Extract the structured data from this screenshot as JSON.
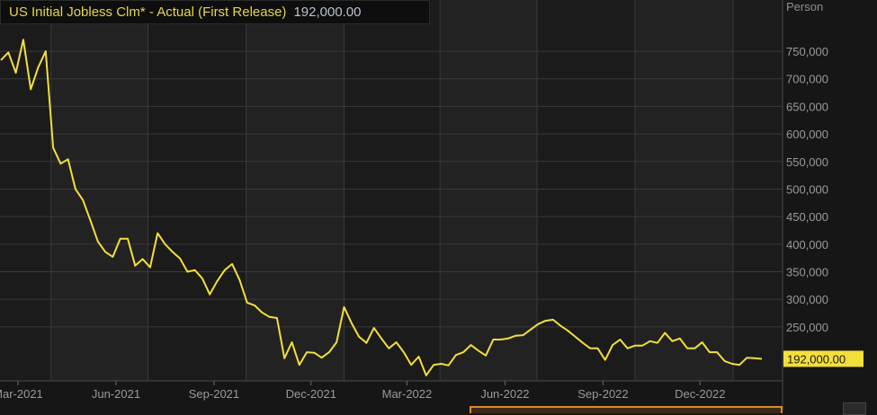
{
  "legend": {
    "series_name": "US Initial Jobless Clm* - Actual (First Release)",
    "last_value": "192,000.00"
  },
  "colors": {
    "line": "#f2df3a",
    "label_bg": "#f2df3a",
    "background": "#1b1b1b",
    "band": "#222222",
    "grid": "#3a3a3a",
    "axis_text": "#9a9a9a"
  },
  "chart_data": {
    "type": "line",
    "title": "US Initial Jobless Clm* - Actual (First Release)",
    "ylabel": "Person",
    "ylim": [
      152000,
      843000
    ],
    "grid": true,
    "frequency": "weekly",
    "start_date": "2021-02-13",
    "last_value_label": "192,000.00",
    "yticks": [
      {
        "value": 750000,
        "label": "750,000"
      },
      {
        "value": 700000,
        "label": "700,000"
      },
      {
        "value": 650000,
        "label": "650,000"
      },
      {
        "value": 600000,
        "label": "600,000"
      },
      {
        "value": 550000,
        "label": "550,000"
      },
      {
        "value": 500000,
        "label": "500,000"
      },
      {
        "value": 450000,
        "label": "450,000"
      },
      {
        "value": 400000,
        "label": "400,000"
      },
      {
        "value": 350000,
        "label": "350,000"
      },
      {
        "value": 300000,
        "label": "300,000"
      },
      {
        "value": 250000,
        "label": "250,000"
      }
    ],
    "xticks": [
      {
        "date": "2021-03-01",
        "label": "Mar-2021"
      },
      {
        "date": "2021-06-01",
        "label": "Jun-2021"
      },
      {
        "date": "2021-09-01",
        "label": "Sep-2021"
      },
      {
        "date": "2021-12-01",
        "label": "Dec-2021"
      },
      {
        "date": "2022-03-01",
        "label": "Mar-2022"
      },
      {
        "date": "2022-06-01",
        "label": "Jun-2022"
      },
      {
        "date": "2022-09-01",
        "label": "Sep-2022"
      },
      {
        "date": "2022-12-01",
        "label": "Dec-2022"
      }
    ],
    "values": [
      734000,
      748000,
      711000,
      771000,
      681000,
      721000,
      750000,
      575000,
      546000,
      554000,
      500000,
      480000,
      443000,
      405000,
      386000,
      377000,
      410000,
      410000,
      361000,
      373000,
      358000,
      420000,
      400000,
      386000,
      374000,
      350000,
      353000,
      338000,
      309000,
      333000,
      353000,
      364000,
      335000,
      294000,
      289000,
      276000,
      268000,
      266000,
      193000,
      222000,
      181000,
      204000,
      203000,
      194000,
      204000,
      222000,
      286000,
      257000,
      232000,
      221000,
      248000,
      229000,
      211000,
      222000,
      204000,
      181000,
      196000,
      162000,
      181000,
      183000,
      180000,
      199000,
      204000,
      217000,
      207000,
      198000,
      227000,
      227000,
      229000,
      234000,
      235000,
      245000,
      255000,
      261000,
      263000,
      252000,
      243000,
      232000,
      221000,
      211000,
      211000,
      190000,
      217000,
      227000,
      211000,
      216000,
      216000,
      224000,
      221000,
      239000,
      224000,
      229000,
      211000,
      211000,
      222000,
      204000,
      204000,
      188000,
      183000,
      181000,
      194000,
      193000,
      192000
    ]
  }
}
